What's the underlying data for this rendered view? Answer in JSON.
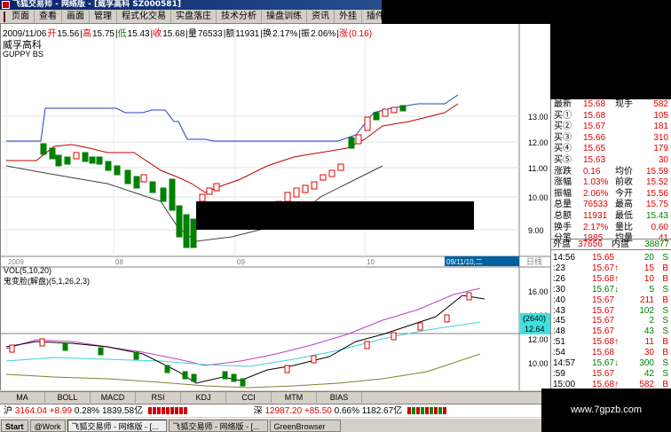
{
  "window": {
    "title": "飞狐交易师 - 网络版 - [威孚高科 SZ000581]"
  },
  "menu": [
    "页面",
    "查看",
    "画面",
    "管理",
    "程式化交易",
    "实盘落庄",
    "技术分析",
    "操盘训练",
    "资讯",
    "外挂",
    "插件"
  ],
  "info": {
    "stock_name": "威孚高科",
    "date": "2009/11/06",
    "open_label": "开",
    "open": "15.56",
    "high_label": "高",
    "high": "15.75",
    "low_label": "低",
    "low": "15.43",
    "close_label": "收",
    "close": "15.68",
    "vol_label": "量",
    "vol": "76533",
    "amt_label": "额",
    "amt": "11931",
    "turn_label": "换",
    "turn": "2.17%",
    "amp_label": "振",
    "amp": "2.06%",
    "chg_label": "涨",
    "chg": "(0.16)"
  },
  "main_chart": {
    "indicator": "GUPPY BS",
    "price_ticks": [
      "13.00",
      "12.00",
      "11.00",
      "10.00",
      "9.00"
    ],
    "date_ticks": [
      "2009",
      "08",
      "09",
      "10"
    ],
    "cursor_date": "09/11/10,二",
    "period": "日线"
  },
  "sub_chart": {
    "vol_label": "VOL(5,10,20)",
    "indicator": "鬼变脸(解盘)(5,1,26,2,3)",
    "ticks": [
      "16.00",
      "14.00",
      "12.00",
      "10.00"
    ],
    "cursor_top": "(2640)",
    "cursor_bottom": "12.64"
  },
  "quote": {
    "rows": [
      {
        "l1": "最新",
        "v1": "15.68",
        "l2": "现手",
        "v2": "582"
      },
      {
        "l1": "买①",
        "v1": "15.68",
        "l2": "",
        "v2": "105"
      },
      {
        "l1": "买②",
        "v1": "15.67",
        "l2": "",
        "v2": "181"
      },
      {
        "l1": "买③",
        "v1": "15.66",
        "l2": "",
        "v2": "310"
      },
      {
        "l1": "买④",
        "v1": "15.65",
        "l2": "",
        "v2": "179"
      },
      {
        "l1": "买⑤",
        "v1": "15.63",
        "l2": "",
        "v2": "30"
      },
      {
        "l1": "涨跌",
        "v1": "0.16",
        "l2": "均价",
        "v2": "15.59"
      },
      {
        "l1": "涨幅",
        "v1": "1.03%",
        "l2": "前收",
        "v2": "15.52"
      },
      {
        "l1": "振幅",
        "v1": "2.06%",
        "l2": "今开",
        "v2": "15.56"
      },
      {
        "l1": "总量",
        "v1": "76533",
        "l2": "最高",
        "v2": "15.75"
      },
      {
        "l1": "总额",
        "v1": "11931",
        "l2": "最低",
        "v2": "15.43"
      },
      {
        "l1": "换手",
        "v1": "2.17%",
        "l2": "量比",
        "v2": "0.60"
      },
      {
        "l1": "分笔",
        "v1": "1885",
        "l2": "均量",
        "v2": "41"
      }
    ],
    "outer_label": "外盘",
    "outer": "37656",
    "inner_label": "内盘",
    "inner": "38877",
    "ticks": [
      {
        "t": "14:56",
        "p": "15.65",
        "v": "20",
        "s": "S"
      },
      {
        "t": ":23",
        "p": "15.67↑",
        "v": "15",
        "s": "B"
      },
      {
        "t": ":26",
        "p": "15.68↑",
        "v": "10",
        "s": "B"
      },
      {
        "t": ":30",
        "p": "15.67↓",
        "v": "5",
        "s": "S"
      },
      {
        "t": ":40",
        "p": "15.67",
        "v": "211",
        "s": "B"
      },
      {
        "t": ":43",
        "p": "15.67",
        "v": "102",
        "s": "S"
      },
      {
        "t": ":45",
        "p": "15.67",
        "v": "2",
        "s": "S"
      },
      {
        "t": ":48",
        "p": "15.67",
        "v": "43",
        "s": "S"
      },
      {
        "t": ":51",
        "p": "15.68↑",
        "v": "11",
        "s": "B"
      },
      {
        "t": ":54",
        "p": "15.68",
        "v": "30",
        "s": "B"
      },
      {
        "t": "14:57",
        "p": "15.67↓",
        "v": "300",
        "s": "S"
      },
      {
        "t": ":59",
        "p": "15.67",
        "v": "42",
        "s": "S"
      },
      {
        "t": "15:00",
        "p": "15.68↑",
        "v": "582",
        "s": "B"
      }
    ]
  },
  "tabs": [
    "MA",
    "BOLL",
    "MACD",
    "RSI",
    "KDJ",
    "CCI",
    "MTM",
    "BIAS"
  ],
  "status": {
    "sh_label": "沪",
    "sh_index": "3164.04",
    "sh_chg": "+8.99",
    "sh_pct": "0.28%",
    "sh_amt": "1839.58亿",
    "sz_label": "深",
    "sz_index": "12987.20",
    "sz_chg": "+85.50",
    "sz_pct": "0.66%",
    "sz_amt": "1182.67亿"
  },
  "taskbar": [
    "Start",
    "@Work",
    "飞狐交易师 - 网络版 - [...",
    "飞狐交易师 - 网络版 - [...",
    "GreenBrowser"
  ],
  "watermark": "www.7gpzb.com",
  "colors": {
    "up": "#e00000",
    "down": "#008000",
    "line_blue": "#2040c0",
    "line_red": "#c00000"
  }
}
